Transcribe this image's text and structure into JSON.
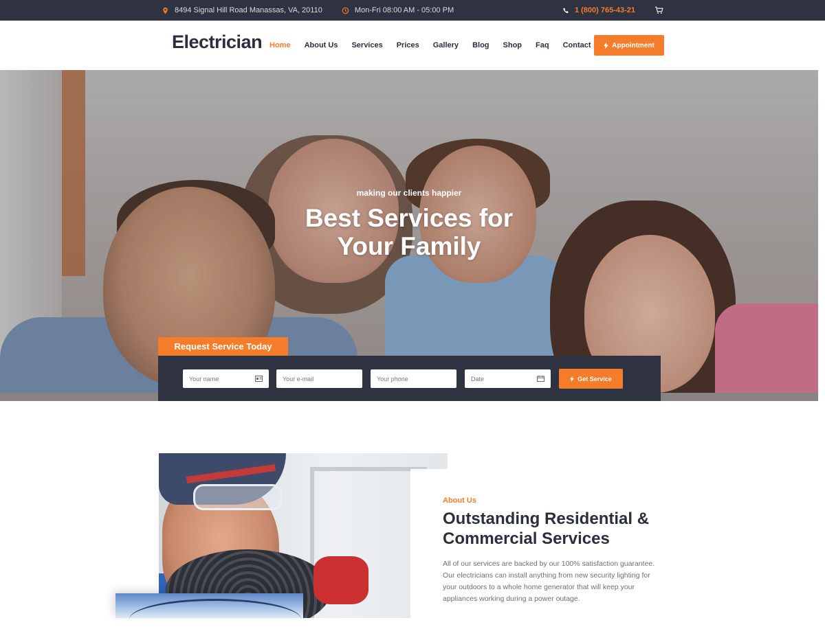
{
  "topbar": {
    "address": "8494 Signal Hill Road Manassas, VA, 20110",
    "hours": "Mon-Fri 08:00 AM - 05:00 PM",
    "phone": "1 (800) 765-43-21"
  },
  "header": {
    "logo": "Electrician",
    "nav": [
      "Home",
      "About Us",
      "Services",
      "Prices",
      "Gallery",
      "Blog",
      "Shop",
      "Faq",
      "Contact"
    ],
    "active_nav": "Home",
    "appointment_label": "Appointment"
  },
  "hero": {
    "tagline": "making our clients happier",
    "title_line1": "Best Services for",
    "title_line2": "Your Family"
  },
  "request": {
    "tab_label": "Request Service Today",
    "name_placeholder": "Your name",
    "email_placeholder": "Your e-mail",
    "phone_placeholder": "Your phone",
    "date_placeholder": "Date",
    "button_label": "Get Service"
  },
  "about": {
    "label": "About Us",
    "title": "Outstanding Residential & Commercial Services",
    "text": "All of our services are backed by our 100% satisfaction guarantee. Our electricians can install anything from new security lighting for your outdoors to a whole home generator that will keep your appliances working during a power outage."
  },
  "colors": {
    "accent": "#f47c2a",
    "dark": "#2f3241",
    "text": "#2b2f3d"
  }
}
